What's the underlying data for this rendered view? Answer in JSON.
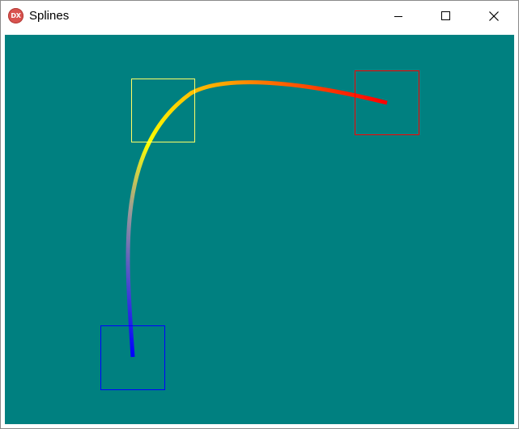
{
  "window": {
    "title": "Splines",
    "icon": "dx-app-icon",
    "icon_text": "DX"
  },
  "caption_buttons": [
    {
      "name": "minimize",
      "icon": "minimize-icon"
    },
    {
      "name": "maximize",
      "icon": "maximize-icon"
    },
    {
      "name": "close",
      "icon": "close-icon"
    }
  ],
  "canvas": {
    "background": "#008080",
    "control_points": [
      {
        "name": "start",
        "color": "#0000ff"
      },
      {
        "name": "control",
        "color": "#ffff66"
      },
      {
        "name": "end",
        "color": "#ff0000"
      }
    ],
    "spline": {
      "gradient": [
        "#0000ff",
        "#999999",
        "#ffff00",
        "#ffa500",
        "#ff0000"
      ]
    }
  }
}
